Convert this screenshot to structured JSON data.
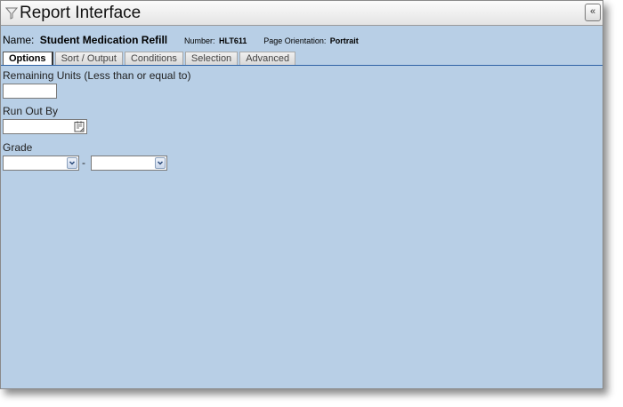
{
  "window": {
    "title": "Report Interface",
    "collapse_label": "«"
  },
  "report": {
    "name_label": "Name:",
    "name_value": "Student Medication Refill",
    "number_label": "Number:",
    "number_value": "HLT611",
    "orientation_label": "Page Orientation:",
    "orientation_value": "Portrait"
  },
  "tabs": [
    {
      "label": "Options",
      "active": true
    },
    {
      "label": "Sort / Output",
      "active": false
    },
    {
      "label": "Conditions",
      "active": false
    },
    {
      "label": "Selection",
      "active": false
    },
    {
      "label": "Advanced",
      "active": false
    }
  ],
  "fields": {
    "remaining_units": {
      "label": "Remaining Units (Less than or equal to)",
      "value": ""
    },
    "run_out_by": {
      "label": "Run Out By",
      "value": ""
    },
    "grade": {
      "label": "Grade",
      "from_value": "",
      "separator": "-",
      "to_value": ""
    }
  },
  "icons": {
    "title": "filter-icon",
    "date_picker": "calendar-icon",
    "dropdown": "chevron-down-icon"
  },
  "colors": {
    "panel_background": "#b8cfe6",
    "tab_underline": "#2f63a6"
  }
}
